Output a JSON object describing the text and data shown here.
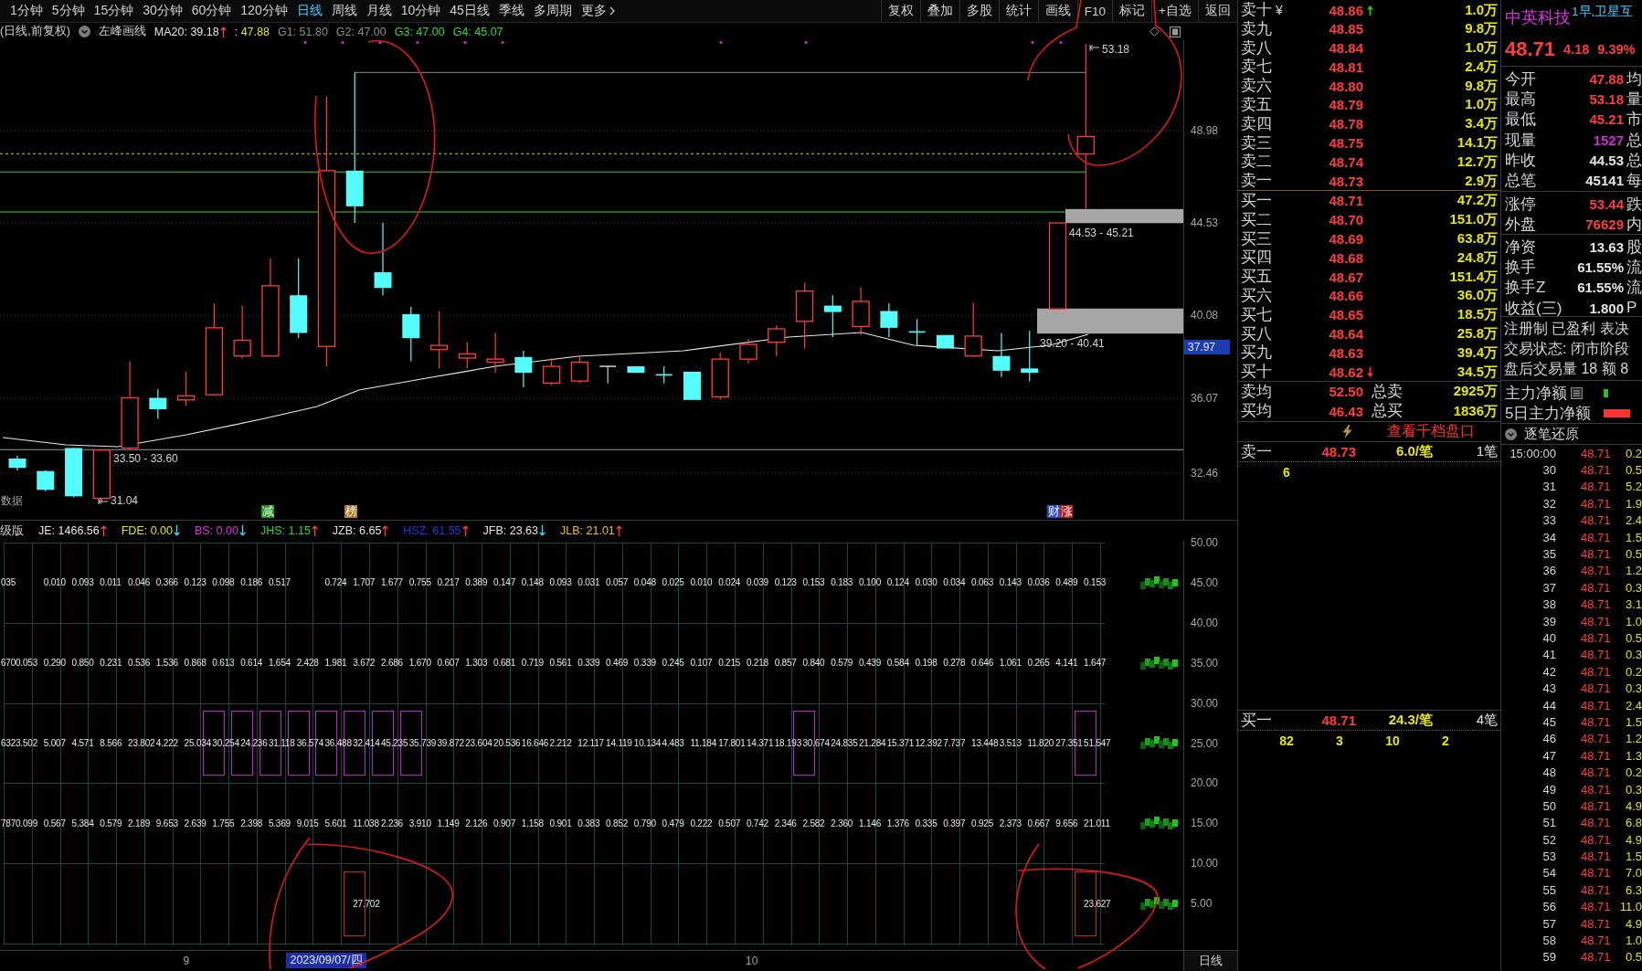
{
  "toolbar": {
    "periods": [
      {
        "label": "1分钟",
        "kind": "period",
        "selected": false
      },
      {
        "label": "5分钟",
        "kind": "period",
        "selected": false
      },
      {
        "label": "15分钟",
        "kind": "period",
        "selected": false
      },
      {
        "label": "30分钟",
        "kind": "period",
        "selected": false
      },
      {
        "label": "60分钟",
        "kind": "period",
        "selected": false
      },
      {
        "label": "120分钟",
        "kind": "period",
        "selected": false
      },
      {
        "label": "日线",
        "kind": "period",
        "selected": true
      },
      {
        "label": "周线",
        "kind": "period",
        "selected": false
      },
      {
        "label": "月线",
        "kind": "period",
        "selected": false
      },
      {
        "label": "10分钟",
        "kind": "period",
        "selected": false
      },
      {
        "label": "45日线",
        "kind": "period",
        "selected": false
      },
      {
        "label": "季线",
        "kind": "period",
        "selected": false
      },
      {
        "label": "多周期",
        "kind": "period",
        "selected": false
      },
      {
        "label": "更多",
        "kind": "menu",
        "selected": false
      }
    ],
    "tools": [
      "复权",
      "叠加",
      "多股",
      "统计",
      "画线",
      "F10",
      "标记",
      "+自选",
      "返回"
    ]
  },
  "chart_header": {
    "mode": "(日线,前复权)",
    "tool": "左峰画线",
    "values": [
      {
        "text": "MA20: 39.18",
        "color": "#e4e4e4",
        "rising": true
      },
      {
        "text": ": 47.88",
        "color": "#e6e600"
      },
      {
        "text": "G1: 51.80",
        "color": "#8a8a8a"
      },
      {
        "text": "G2: 47.00",
        "color": "#8a8a8a"
      },
      {
        "text": "G3: 47.00",
        "color": "#2ed82e"
      },
      {
        "text": "G4: 45.07",
        "color": "#2ed82e"
      }
    ]
  },
  "main_chart": {
    "high_mark": "53.18",
    "low_mark": "31.04",
    "zones": [
      "44.53 - 45.21",
      "39.20 - 40.41"
    ],
    "range_label": "33.50 - 33.60",
    "side_label": "数据",
    "event_tags": [
      {
        "text": "减",
        "color": "#1c9a1c"
      },
      {
        "text": "榜",
        "color": "#b07a22"
      },
      {
        "text": "财",
        "color": "#2a4ec8"
      },
      {
        "text": "涨",
        "color": "#b81c1c"
      }
    ],
    "price_axis": [
      "48.98",
      "44.53",
      "40.08",
      "36.07",
      "32.46"
    ],
    "cursor_price": "37.97"
  },
  "indicator": {
    "title": "级版",
    "values": [
      {
        "text": "JE: 1466.56",
        "color": "#e4e4e4",
        "rising": true
      },
      {
        "text": "FDE: 0.00",
        "color": "#e6e600",
        "rising": false
      },
      {
        "text": "BS: 0.00",
        "color": "#e030e0",
        "rising": false
      },
      {
        "text": "JHS: 1.15",
        "color": "#2ed82e",
        "rising": true
      },
      {
        "text": "JZB: 6.65",
        "color": "#e4e4e4",
        "rising": true
      },
      {
        "text": "HSZ: 61.55",
        "color": "#2a32e6",
        "rising": true
      },
      {
        "text": "JFB: 23.63",
        "color": "#e4e4e4",
        "rising": false
      },
      {
        "text": "JLB: 21.01",
        "color": "#f0c010",
        "rising": true
      }
    ],
    "axis": [
      "50.00",
      "45.00",
      "40.00",
      "35.00",
      "30.00",
      "25.00",
      "20.00",
      "15.00",
      "10.00",
      "5.00"
    ],
    "rows": [
      {
        "cells": [
          "035",
          null,
          "0.010",
          "0.093",
          "0.011",
          "0.046",
          "0.366",
          "0.123",
          "0.098",
          "0.186",
          "0.517",
          null,
          "0.724",
          "1.707",
          "1.677",
          "0.755",
          "0.217",
          "0.389",
          "0.147",
          "0.148",
          "0.093",
          "0.031",
          "0.057",
          "0.048",
          "0.025",
          "0.010",
          "0.024",
          "0.039",
          "0.123",
          "0.153",
          "0.183",
          "0.100",
          "0.124",
          "0.030",
          "0.034",
          "0.063",
          "0.143",
          "0.036",
          "0.489",
          "0.153"
        ]
      },
      {
        "cells": [
          "670",
          "0.053",
          "0.290",
          "0.850",
          "0.231",
          "0.536",
          "1.536",
          "0.868",
          "0.613",
          "0.614",
          "1.654",
          "2.428",
          "1.981",
          "3.672",
          "2.686",
          "1.670",
          "0.607",
          "1.303",
          "0.681",
          "0.719",
          "0.561",
          "0.339",
          "0.469",
          "0.339",
          "0.245",
          "0.107",
          "0.215",
          "0.218",
          "0.857",
          "0.840",
          "0.579",
          "0.439",
          "0.584",
          "0.198",
          "0.278",
          "0.646",
          "1.061",
          "0.265",
          "4.141",
          "1.647"
        ]
      },
      {
        "color": "#c020c8",
        "cells": [
          {
            "text": "632",
            "boxed": false
          },
          {
            "text": "3.502",
            "boxed": false
          },
          {
            "text": "5.007",
            "boxed": false
          },
          {
            "text": "4.571",
            "boxed": false
          },
          {
            "text": "8.566",
            "boxed": false
          },
          {
            "text": "23.802",
            "boxed": false
          },
          {
            "text": "4.222",
            "boxed": false
          },
          {
            "text": "25.034",
            "boxed": false
          },
          {
            "text": "30.254",
            "boxed": true
          },
          {
            "text": "24.236",
            "boxed": true
          },
          {
            "text": "31.118",
            "boxed": true
          },
          {
            "text": "36.574",
            "boxed": true
          },
          {
            "text": "36.488",
            "boxed": true
          },
          {
            "text": "32.414",
            "boxed": true
          },
          {
            "text": "45.235",
            "boxed": true
          },
          {
            "text": "35.739",
            "boxed": true
          },
          {
            "text": "39.872",
            "boxed": false
          },
          {
            "text": "23.604",
            "boxed": false
          },
          {
            "text": "20.536",
            "boxed": false
          },
          {
            "text": "16.646",
            "boxed": false
          },
          {
            "text": "2.212",
            "boxed": false
          },
          {
            "text": "12.117",
            "boxed": false
          },
          {
            "text": "14.119",
            "boxed": false
          },
          {
            "text": "10.134",
            "boxed": false
          },
          {
            "text": "4.483",
            "boxed": false
          },
          {
            "text": "11.184",
            "boxed": false
          },
          {
            "text": "17.801",
            "boxed": false
          },
          {
            "text": "14.371",
            "boxed": false
          },
          {
            "text": "18.193",
            "boxed": false
          },
          {
            "text": "30.674",
            "boxed": true
          },
          {
            "text": "24.835",
            "boxed": false
          },
          {
            "text": "21.284",
            "boxed": false
          },
          {
            "text": "15.371",
            "boxed": false
          },
          {
            "text": "12.392",
            "boxed": false
          },
          {
            "text": "7.737",
            "boxed": false
          },
          {
            "text": "13.448",
            "boxed": false
          },
          {
            "text": "3.513",
            "boxed": false
          },
          {
            "text": "11.820",
            "boxed": false
          },
          {
            "text": "27.351",
            "boxed": false
          },
          {
            "text": "51.547",
            "boxed": true
          }
        ]
      },
      {
        "cells": [
          "787",
          "0.099",
          "0.567",
          "5.384",
          "0.579",
          "2.189",
          "9.653",
          "2.639",
          "1.755",
          "2.398",
          "5.369",
          "9.015",
          "5.601",
          "11.038",
          "2.236",
          "3.910",
          "1.149",
          "2.126",
          "0.907",
          "1.158",
          "0.901",
          "0.383",
          "0.852",
          "0.790",
          "0.479",
          "0.222",
          "0.507",
          "0.742",
          "2.346",
          "2.582",
          "2.360",
          "1.146",
          "1.376",
          "0.335",
          "0.397",
          "0.925",
          "2.373",
          "0.667",
          "9.656",
          "21.011"
        ]
      },
      {
        "color": "#d42020",
        "cells": [
          null,
          null,
          null,
          null,
          null,
          null,
          null,
          null,
          null,
          null,
          null,
          null,
          null,
          {
            "text": "27.702",
            "boxed": true
          },
          null,
          null,
          null,
          null,
          null,
          null,
          null,
          null,
          null,
          null,
          null,
          null,
          null,
          null,
          null,
          null,
          null,
          null,
          null,
          null,
          null,
          null,
          null,
          null,
          null,
          {
            "text": "23.627",
            "boxed": true
          }
        ]
      }
    ]
  },
  "date_axis": {
    "ticks": [
      "9",
      "10"
    ],
    "cursor_date": "2023/09/07/四",
    "period": "日线"
  },
  "order_book": {
    "currency": "¥",
    "asks": [
      {
        "label": "卖十",
        "price": "48.86",
        "volume": "1.0万",
        "rising": true
      },
      {
        "label": "卖九",
        "price": "48.85",
        "volume": "9.8万"
      },
      {
        "label": "卖八",
        "price": "48.84",
        "volume": "1.0万"
      },
      {
        "label": "卖七",
        "price": "48.81",
        "volume": "2.4万"
      },
      {
        "label": "卖六",
        "price": "48.80",
        "volume": "9.8万"
      },
      {
        "label": "卖五",
        "price": "48.79",
        "volume": "1.0万"
      },
      {
        "label": "卖四",
        "price": "48.78",
        "volume": "3.4万"
      },
      {
        "label": "卖三",
        "price": "48.75",
        "volume": "14.1万"
      },
      {
        "label": "卖二",
        "price": "48.74",
        "volume": "12.7万"
      },
      {
        "label": "卖一",
        "price": "48.73",
        "volume": "2.9万"
      }
    ],
    "bids": [
      {
        "label": "买一",
        "price": "48.71",
        "volume": "47.2万"
      },
      {
        "label": "买二",
        "price": "48.70",
        "volume": "151.0万"
      },
      {
        "label": "买三",
        "price": "48.69",
        "volume": "63.8万"
      },
      {
        "label": "买四",
        "price": "48.68",
        "volume": "24.8万"
      },
      {
        "label": "买五",
        "price": "48.67",
        "volume": "151.4万"
      },
      {
        "label": "买六",
        "price": "48.66",
        "volume": "36.0万"
      },
      {
        "label": "买七",
        "price": "48.65",
        "volume": "18.5万"
      },
      {
        "label": "买八",
        "price": "48.64",
        "volume": "25.8万"
      },
      {
        "label": "买九",
        "price": "48.63",
        "volume": "39.4万"
      },
      {
        "label": "买十",
        "price": "48.62",
        "volume": "34.5万",
        "rising": false
      }
    ],
    "averages": [
      {
        "label": "卖均",
        "price": "52.50",
        "total_label": "总卖",
        "total": "2925万"
      },
      {
        "label": "买均",
        "price": "46.43",
        "total_label": "总买",
        "total": "1836万"
      }
    ],
    "link": "查看千档盘口",
    "queues": [
      {
        "label": "卖一",
        "price": "48.73",
        "per_order": "6.0/笔",
        "orders": "1笔",
        "sizes": [
          "6"
        ]
      },
      {
        "label": "买一",
        "price": "48.71",
        "per_order": "24.3/笔",
        "orders": "4笔",
        "sizes": [
          "82",
          "3",
          "10",
          "2"
        ]
      }
    ]
  },
  "quote": {
    "name": "中英科技",
    "concept": "1早,卫星互",
    "price": "48.71",
    "change": "4.18",
    "change_pct": "9.39%",
    "groups": [
      [
        {
          "label": "今开",
          "value": "47.88",
          "color": "#ff3c3c",
          "tail": "均"
        },
        {
          "label": "最高",
          "value": "53.18",
          "color": "#ff3c3c",
          "tail": "量"
        },
        {
          "label": "最低",
          "value": "45.21",
          "color": "#ff3c3c",
          "tail": "市"
        },
        {
          "label": "现量",
          "value": "1527",
          "color": "#d028d8",
          "tail": "总"
        },
        {
          "label": "昨收",
          "value": "44.53",
          "color": "#e4e4e4",
          "tail": "总"
        },
        {
          "label": "总笔",
          "value": "45141",
          "color": "#e4e4e4",
          "tail": "每"
        }
      ],
      [
        {
          "label": "涨停",
          "value": "53.44",
          "color": "#ff3c3c",
          "tail": "跌"
        },
        {
          "label": "外盘",
          "value": "76629",
          "color": "#ff3c3c",
          "tail": "内"
        }
      ],
      [
        {
          "label": "净资",
          "value": "13.63",
          "color": "#e4e4e4",
          "tail": "股"
        },
        {
          "label": "换手",
          "value": "61.55%",
          "color": "#e4e4e4",
          "tail": "流"
        },
        {
          "label": "换手Z",
          "value": "61.55%",
          "color": "#e4e4e4",
          "tail": "流"
        },
        {
          "label": "收益(三)",
          "value": "1.800",
          "color": "#e4e4e4",
          "tail": "P"
        }
      ]
    ],
    "notes": [
      "注册制 已盈利 表决",
      "交易状态: 闭市阶段",
      "盘后交易量 18 额 8"
    ],
    "flows": [
      {
        "label": "主力净额",
        "color": "#20c020",
        "detail_icon": true
      },
      {
        "label": "5日主力净额",
        "color": "#ff3030",
        "detail_icon": false
      }
    ]
  },
  "ticks": {
    "title": "逐笔还原",
    "rows": [
      {
        "time": "15:00:00",
        "price": "48.71",
        "volume": "0.2"
      },
      {
        "time": "30",
        "price": "48.71",
        "volume": "0.5"
      },
      {
        "time": "31",
        "price": "48.71",
        "volume": "5.2"
      },
      {
        "time": "32",
        "price": "48.71",
        "volume": "1.9"
      },
      {
        "time": "33",
        "price": "48.71",
        "volume": "2.4"
      },
      {
        "time": "34",
        "price": "48.71",
        "volume": "1.5"
      },
      {
        "time": "35",
        "price": "48.71",
        "volume": "0.5"
      },
      {
        "time": "36",
        "price": "48.71",
        "volume": "1.2"
      },
      {
        "time": "37",
        "price": "48.71",
        "volume": "0.3"
      },
      {
        "time": "38",
        "price": "48.71",
        "volume": "3.1"
      },
      {
        "time": "39",
        "price": "48.71",
        "volume": "1.0"
      },
      {
        "time": "40",
        "price": "48.71",
        "volume": "0.5"
      },
      {
        "time": "41",
        "price": "48.71",
        "volume": "0.3"
      },
      {
        "time": "42",
        "price": "48.71",
        "volume": "0.2"
      },
      {
        "time": "43",
        "price": "48.71",
        "volume": "0.3"
      },
      {
        "time": "44",
        "price": "48.71",
        "volume": "2.4"
      },
      {
        "time": "45",
        "price": "48.71",
        "volume": "1.5"
      },
      {
        "time": "46",
        "price": "48.71",
        "volume": "1.2"
      },
      {
        "time": "47",
        "price": "48.71",
        "volume": "1.3"
      },
      {
        "time": "48",
        "price": "48.71",
        "volume": "0.2"
      },
      {
        "time": "49",
        "price": "48.71",
        "volume": "0.3"
      },
      {
        "time": "50",
        "price": "48.71",
        "volume": "4.9"
      },
      {
        "time": "51",
        "price": "48.71",
        "volume": "6.8"
      },
      {
        "time": "52",
        "price": "48.71",
        "volume": "4.9"
      },
      {
        "time": "53",
        "price": "48.71",
        "volume": "1.5"
      },
      {
        "time": "54",
        "price": "48.71",
        "volume": "7.0"
      },
      {
        "time": "55",
        "price": "48.71",
        "volume": "6.3"
      },
      {
        "time": "56",
        "price": "48.71",
        "volume": "11.0"
      },
      {
        "time": "57",
        "price": "48.71",
        "volume": "4.9"
      },
      {
        "time": "58",
        "price": "48.71",
        "volume": "1.0"
      },
      {
        "time": "59",
        "price": "48.71",
        "volume": "0.5"
      }
    ]
  }
}
